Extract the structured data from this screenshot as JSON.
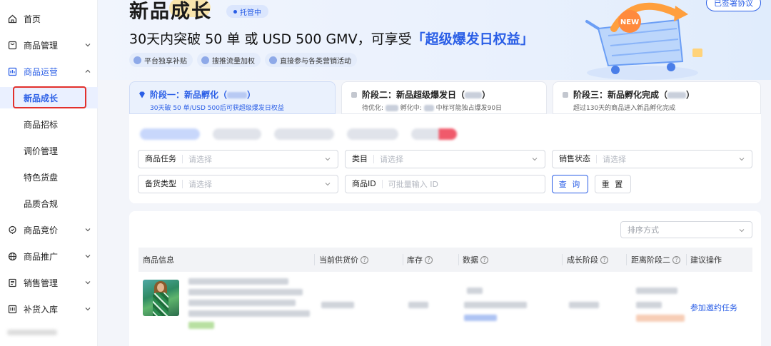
{
  "sidebar": {
    "items": [
      {
        "label": "首页"
      },
      {
        "label": "商品管理"
      },
      {
        "label": "商品运营"
      },
      {
        "label": "新品成长"
      },
      {
        "label": "商品招标"
      },
      {
        "label": "调价管理"
      },
      {
        "label": "特色货盘"
      },
      {
        "label": "品质合规"
      },
      {
        "label": "商品竞价"
      },
      {
        "label": "商品推广"
      },
      {
        "label": "销售管理"
      },
      {
        "label": "补货入库"
      }
    ]
  },
  "hero": {
    "title": "新品成长",
    "hosted_badge": "托管中",
    "agreement_button": "已签署协议",
    "headline_prefix": "30天内突破 50 单 或 USD 500 GMV，可享受",
    "headline_emphasis": "「超级爆发日权益」",
    "perks": [
      "平台独享补贴",
      "搜推流量加权",
      "直接参与各类营销活动"
    ]
  },
  "stages": [
    {
      "title": "阶段一：新品孵化（",
      "title_end": "）",
      "subtitle": "30天破 50 单/USD 500后可获超级爆发日权益"
    },
    {
      "title": "阶段二：新品超级爆发日（",
      "title_end": "）",
      "subtitle_a": "待优化:",
      "subtitle_b": "孵化中:",
      "subtitle_c": "中标可能独占爆发90日"
    },
    {
      "title": "阶段三：新品孵化完成（",
      "title_end": "）",
      "subtitle": "超过130天的商品进入新品孵化完成"
    }
  ],
  "filters": {
    "product_task": {
      "label": "商品任务",
      "placeholder": "请选择"
    },
    "category": {
      "label": "类目",
      "placeholder": "请选择"
    },
    "sales_status": {
      "label": "销售状态",
      "placeholder": "请选择"
    },
    "stock_type": {
      "label": "备货类型",
      "placeholder": "请选择"
    },
    "product_id": {
      "label": "商品ID",
      "placeholder": "可批量输入 ID"
    },
    "query_button": "查 询",
    "reset_button": "重 置"
  },
  "table": {
    "sort_placeholder": "排序方式",
    "headers": [
      "商品信息",
      "当前供货价",
      "库存",
      "数据",
      "成长阶段",
      "距离阶段二",
      "建议操作"
    ],
    "rows": [
      {
        "action": "参加邀约任务"
      }
    ]
  },
  "colors": {
    "accent": "#2a5ee6",
    "highlight_border": "#e2302c"
  }
}
